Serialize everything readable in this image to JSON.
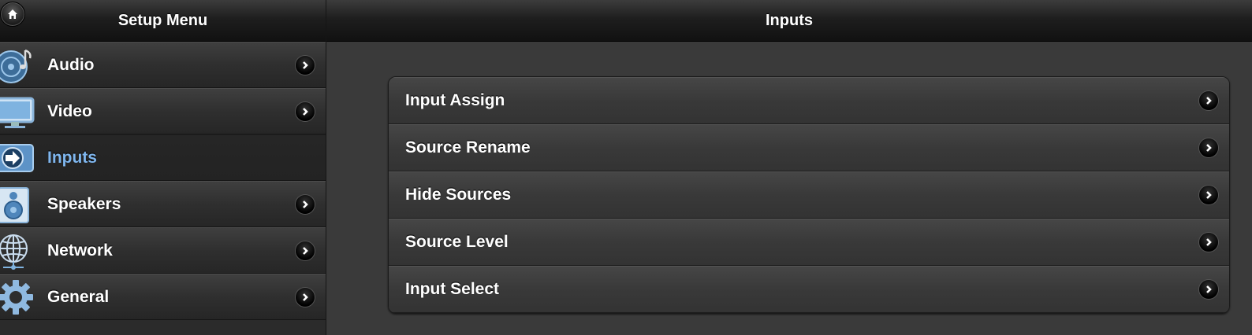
{
  "sidebar": {
    "title": "Setup Menu",
    "items": [
      {
        "label": "Audio",
        "icon": "audio-disc-icon",
        "active": false
      },
      {
        "label": "Video",
        "icon": "monitor-icon",
        "active": false
      },
      {
        "label": "Inputs",
        "icon": "input-arrow-icon",
        "active": true
      },
      {
        "label": "Speakers",
        "icon": "speaker-icon",
        "active": false
      },
      {
        "label": "Network",
        "icon": "globe-network-icon",
        "active": false
      },
      {
        "label": "General",
        "icon": "gear-icon",
        "active": false
      }
    ]
  },
  "main": {
    "title": "Inputs",
    "items": [
      {
        "label": "Input Assign"
      },
      {
        "label": "Source Rename"
      },
      {
        "label": "Hide Sources"
      },
      {
        "label": "Source Level"
      },
      {
        "label": "Input Select"
      }
    ]
  },
  "colors": {
    "active_text": "#7fb6ee",
    "icon_blue": "#5b9fd8"
  }
}
